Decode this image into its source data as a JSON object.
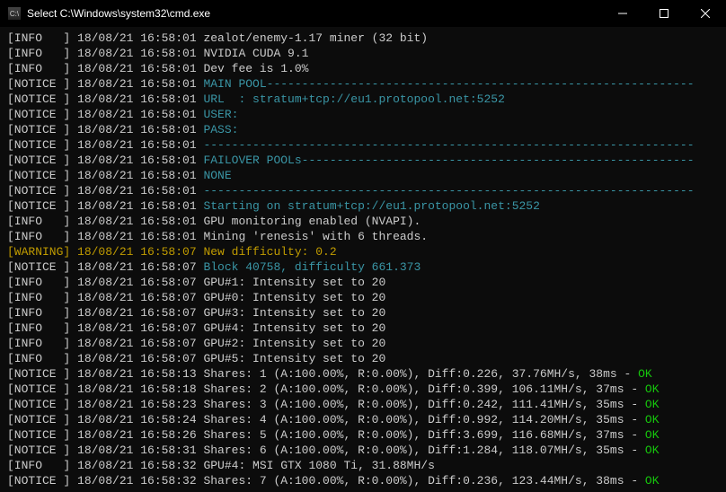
{
  "window": {
    "title": "Select C:\\Windows\\system32\\cmd.exe",
    "icon_label": "C:\\"
  },
  "colors": {
    "bg": "#0c0c0c",
    "fg": "#cccccc",
    "teal": "#3a96a6",
    "yellow": "#c19c00",
    "green": "#16c60c"
  },
  "log": [
    {
      "level": "INFO",
      "ts": "18/08/21 16:58:01",
      "segments": [
        {
          "text": "zealot/enemy-1.17 miner (32 bit)",
          "c": "default"
        }
      ]
    },
    {
      "level": "INFO",
      "ts": "18/08/21 16:58:01",
      "segments": [
        {
          "text": "NVIDIA CUDA 9.1",
          "c": "default"
        }
      ]
    },
    {
      "level": "INFO",
      "ts": "18/08/21 16:58:01",
      "segments": [
        {
          "text": "Dev fee is 1.0%",
          "c": "default"
        }
      ]
    },
    {
      "level": "NOTICE",
      "ts": "18/08/21 16:58:01",
      "segments": [
        {
          "text": "MAIN POOL",
          "c": "teal"
        },
        {
          "text": "dashfill",
          "c": "dashfill"
        }
      ]
    },
    {
      "level": "NOTICE",
      "ts": "18/08/21 16:58:01",
      "segments": [
        {
          "text": "URL  : stratum+tcp://eu1.protopool.net:5252",
          "c": "teal"
        }
      ]
    },
    {
      "level": "NOTICE",
      "ts": "18/08/21 16:58:01",
      "segments": [
        {
          "text": "USER:",
          "c": "teal"
        }
      ]
    },
    {
      "level": "NOTICE",
      "ts": "18/08/21 16:58:01",
      "segments": [
        {
          "text": "PASS:",
          "c": "teal"
        }
      ]
    },
    {
      "level": "NOTICE",
      "ts": "18/08/21 16:58:01",
      "segments": [
        {
          "text": "dashfill",
          "c": "dashfill"
        }
      ]
    },
    {
      "level": "NOTICE",
      "ts": "18/08/21 16:58:01",
      "segments": [
        {
          "text": "FAILOVER POOLs",
          "c": "teal"
        },
        {
          "text": "dashfill",
          "c": "dashfill"
        }
      ]
    },
    {
      "level": "NOTICE",
      "ts": "18/08/21 16:58:01",
      "segments": [
        {
          "text": "NONE",
          "c": "teal"
        }
      ]
    },
    {
      "level": "NOTICE",
      "ts": "18/08/21 16:58:01",
      "segments": [
        {
          "text": "dashfill",
          "c": "dashfill"
        }
      ]
    },
    {
      "level": "NOTICE",
      "ts": "18/08/21 16:58:01",
      "segments": [
        {
          "text": "Starting on stratum+tcp://eu1.protopool.net:5252",
          "c": "teal"
        }
      ]
    },
    {
      "level": "INFO",
      "ts": "18/08/21 16:58:01",
      "segments": [
        {
          "text": "GPU monitoring enabled (NVAPI).",
          "c": "default"
        }
      ]
    },
    {
      "level": "INFO",
      "ts": "18/08/21 16:58:01",
      "segments": [
        {
          "text": "Mining 'renesis' with 6 threads.",
          "c": "default"
        }
      ]
    },
    {
      "level": "WARNING",
      "ts": "18/08/21 16:58:07",
      "segments": [
        {
          "text": "New difficulty: 0.2",
          "c": "yellow"
        }
      ]
    },
    {
      "level": "NOTICE",
      "ts": "18/08/21 16:58:07",
      "segments": [
        {
          "text": "Block 40758, difficulty 661.373",
          "c": "teal"
        }
      ]
    },
    {
      "level": "INFO",
      "ts": "18/08/21 16:58:07",
      "segments": [
        {
          "text": "GPU#1: Intensity set to 20",
          "c": "default"
        }
      ]
    },
    {
      "level": "INFO",
      "ts": "18/08/21 16:58:07",
      "segments": [
        {
          "text": "GPU#0: Intensity set to 20",
          "c": "default"
        }
      ]
    },
    {
      "level": "INFO",
      "ts": "18/08/21 16:58:07",
      "segments": [
        {
          "text": "GPU#3: Intensity set to 20",
          "c": "default"
        }
      ]
    },
    {
      "level": "INFO",
      "ts": "18/08/21 16:58:07",
      "segments": [
        {
          "text": "GPU#4: Intensity set to 20",
          "c": "default"
        }
      ]
    },
    {
      "level": "INFO",
      "ts": "18/08/21 16:58:07",
      "segments": [
        {
          "text": "GPU#2: Intensity set to 20",
          "c": "default"
        }
      ]
    },
    {
      "level": "INFO",
      "ts": "18/08/21 16:58:07",
      "segments": [
        {
          "text": "GPU#5: Intensity set to 20",
          "c": "default"
        }
      ]
    },
    {
      "level": "NOTICE",
      "ts": "18/08/21 16:58:13",
      "segments": [
        {
          "text": "Shares: 1 (A:100.00%, R:0.00%), Diff:0.226, 37.76MH/s, 38ms - ",
          "c": "default"
        },
        {
          "text": "OK",
          "c": "green"
        }
      ]
    },
    {
      "level": "NOTICE",
      "ts": "18/08/21 16:58:18",
      "segments": [
        {
          "text": "Shares: 2 (A:100.00%, R:0.00%), Diff:0.399, 106.11MH/s, 37ms - ",
          "c": "default"
        },
        {
          "text": "OK",
          "c": "green"
        }
      ]
    },
    {
      "level": "NOTICE",
      "ts": "18/08/21 16:58:23",
      "segments": [
        {
          "text": "Shares: 3 (A:100.00%, R:0.00%), Diff:0.242, 111.41MH/s, 35ms - ",
          "c": "default"
        },
        {
          "text": "OK",
          "c": "green"
        }
      ]
    },
    {
      "level": "NOTICE",
      "ts": "18/08/21 16:58:24",
      "segments": [
        {
          "text": "Shares: 4 (A:100.00%, R:0.00%), Diff:0.992, 114.20MH/s, 35ms - ",
          "c": "default"
        },
        {
          "text": "OK",
          "c": "green"
        }
      ]
    },
    {
      "level": "NOTICE",
      "ts": "18/08/21 16:58:26",
      "segments": [
        {
          "text": "Shares: 5 (A:100.00%, R:0.00%), Diff:3.699, 116.68MH/s, 37ms - ",
          "c": "default"
        },
        {
          "text": "OK",
          "c": "green"
        }
      ]
    },
    {
      "level": "NOTICE",
      "ts": "18/08/21 16:58:31",
      "segments": [
        {
          "text": "Shares: 6 (A:100.00%, R:0.00%), Diff:1.284, 118.07MH/s, 35ms - ",
          "c": "default"
        },
        {
          "text": "OK",
          "c": "green"
        }
      ]
    },
    {
      "level": "INFO",
      "ts": "18/08/21 16:58:32",
      "segments": [
        {
          "text": "GPU#4: MSI GTX 1080 Ti, 31.88MH/s",
          "c": "default"
        }
      ]
    },
    {
      "level": "NOTICE",
      "ts": "18/08/21 16:58:32",
      "segments": [
        {
          "text": "Shares: 7 (A:100.00%, R:0.00%), Diff:0.236, 123.44MH/s, 38ms - ",
          "c": "default"
        },
        {
          "text": "OK",
          "c": "green"
        }
      ]
    }
  ]
}
